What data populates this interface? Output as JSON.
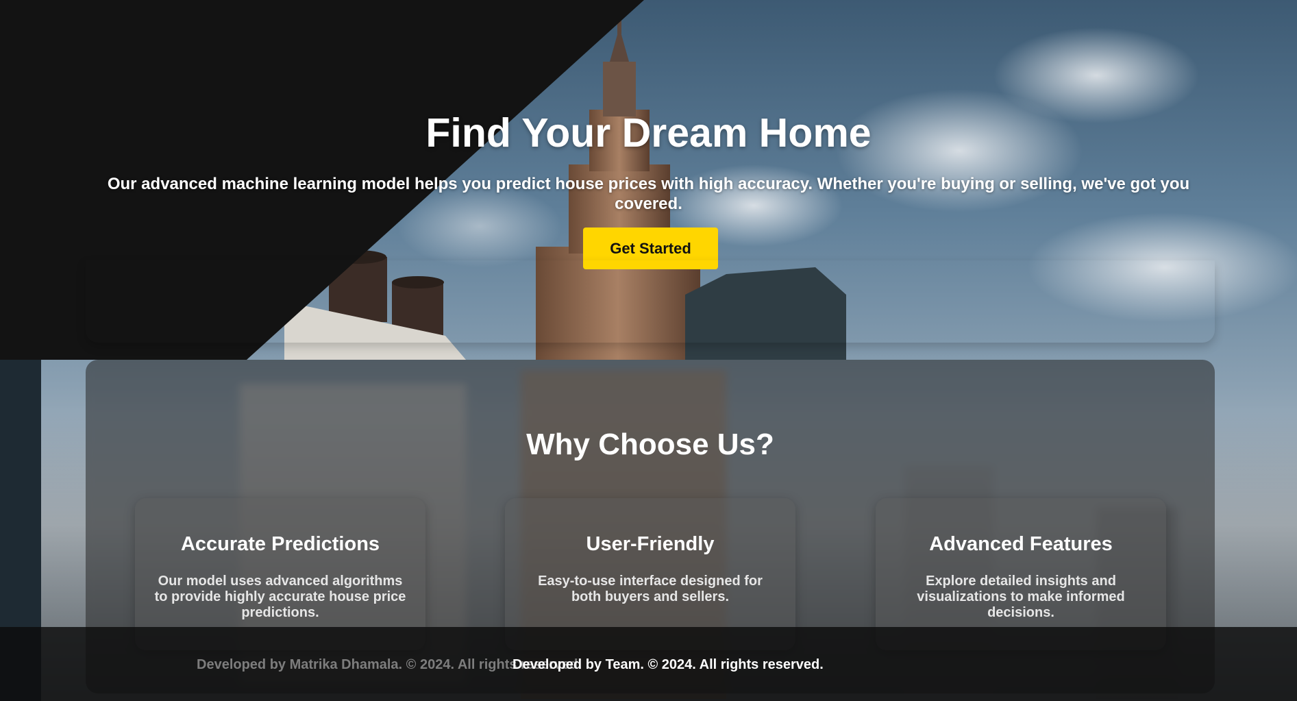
{
  "hero": {
    "title": "Find Your Dream Home",
    "subtitle": "Our advanced machine learning model helps you predict house prices with high accuracy. Whether you're buying or selling, we've got you covered.",
    "cta_label": "Get Started",
    "cta_color": "#ffd600"
  },
  "why": {
    "title": "Why Choose Us?",
    "cards": [
      {
        "title": "Accurate Predictions",
        "text": "Our model uses advanced algorithms to provide highly accurate house price predictions."
      },
      {
        "title": "User-Friendly",
        "text": "Easy-to-use interface designed for both buyers and sellers."
      },
      {
        "title": "Advanced Features",
        "text": "Explore detailed insights and visualizations to make informed decisions."
      }
    ]
  },
  "footer": {
    "ghost_text": "Developed by Matrika Dhamala. © 2024. All rights reserved.",
    "text": "Developed by Team. © 2024. All rights reserved."
  }
}
